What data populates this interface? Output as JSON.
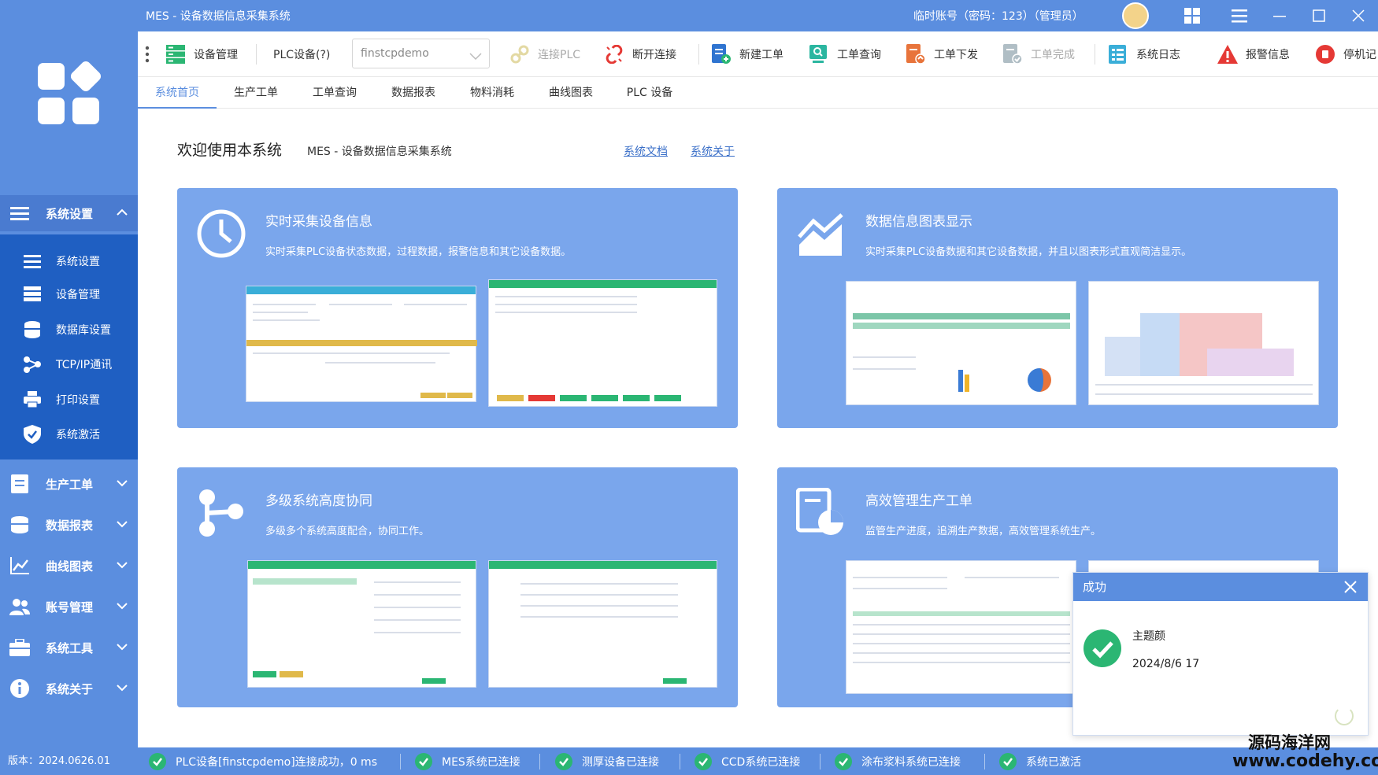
{
  "app": {
    "title": "MES - 设备数据信息采集系统",
    "account": "临时账号（密码：123）（管理员）",
    "version": "版本：2024.0626.01"
  },
  "toolbar": {
    "device_mgmt": "设备管理",
    "plc_label": "PLC设备(?)",
    "plc_select_value": "finstcpdemo",
    "connect_plc": "连接PLC",
    "disconnect": "断开连接",
    "new_order": "新建工单",
    "order_query": "工单查询",
    "order_issue": "工单下发",
    "order_complete": "工单完成",
    "system_log": "系统日志",
    "alarm_info": "报警信息",
    "stop_record": "停机记"
  },
  "tabs": [
    "系统首页",
    "生产工单",
    "工单查询",
    "数据报表",
    "物料消耗",
    "曲线图表",
    "PLC 设备"
  ],
  "sidebar": {
    "group_open": "系统设置",
    "sub_items": [
      "系统设置",
      "设备管理",
      "数据库设置",
      "TCP/IP通讯",
      "打印设置",
      "系统激活"
    ],
    "groups": [
      "生产工单",
      "数据报表",
      "曲线图表",
      "账号管理",
      "系统工具",
      "系统关于"
    ]
  },
  "main": {
    "welcome": "欢迎使用本系统",
    "welcome_sub": "MES - 设备数据信息采集系统",
    "link_docs": "系统文档",
    "link_about": "系统关于",
    "cards": [
      {
        "title": "实时采集设备信息",
        "desc": "实时采集PLC设备状态数据，过程数据，报警信息和其它设备数据。"
      },
      {
        "title": "数据信息图表显示",
        "desc": "实时采集PLC设备数据和其它设备数据，并且以图表形式直观简洁显示。"
      },
      {
        "title": "多级系统高度协同",
        "desc": "多级多个系统高度配合，协同工作。"
      },
      {
        "title": "高效管理生产工单",
        "desc": "监管生产进度，追溯生产数据，高效管理系统生产。"
      }
    ]
  },
  "toast": {
    "title": "成功",
    "message": "主题颜",
    "time": "2024/8/6 17"
  },
  "status": [
    "PLC设备[finstcpdemo]连接成功，0 ms",
    "MES系统已连接",
    "测厚设备已连接",
    "CCD系统已连接",
    "涂布浆料系统已连接",
    "系统已激活"
  ],
  "watermark": {
    "line1": "源码海洋网",
    "line2": "www.codehy.com"
  },
  "colors": {
    "primary": "#5b8edf",
    "sidebar_active": "#1f5fc2",
    "card": "#7aa6ec",
    "success": "#2bb673",
    "alarm": "#e53935"
  }
}
